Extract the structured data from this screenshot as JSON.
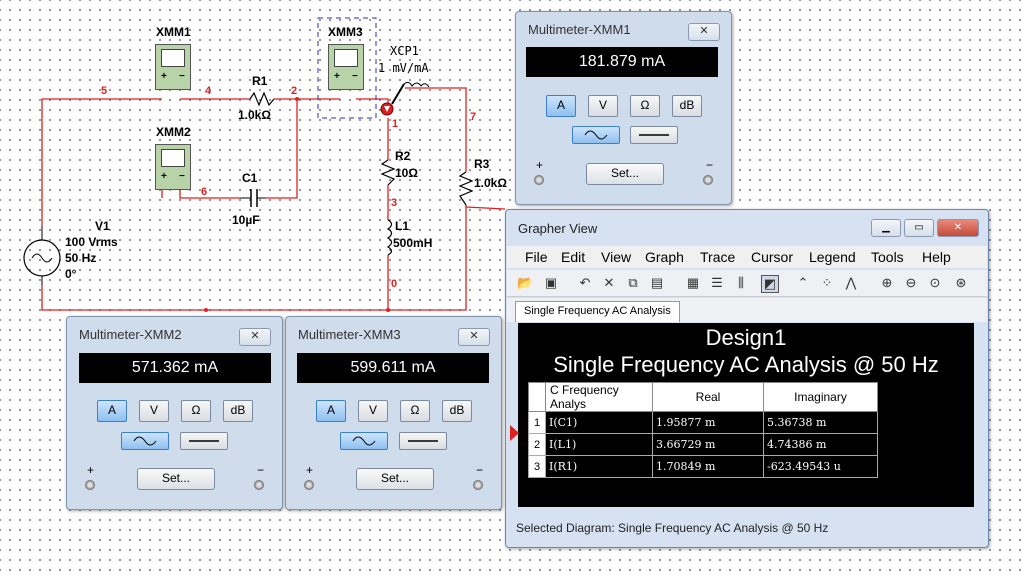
{
  "schematic": {
    "xmm1": "XMM1",
    "xmm2": "XMM2",
    "xmm3": "XMM3",
    "xcp1": "XCP1",
    "xcp1_value": "1  mV/mA",
    "r1": "R1",
    "r1_value": "1.0kΩ",
    "c1": "C1",
    "c1_value": "10µF",
    "r2": "R2",
    "r2_value": "10Ω",
    "l1": "L1",
    "l1_value": "500mH",
    "r3": "R3",
    "r3_value": "1.0kΩ",
    "v1": "V1",
    "v1_amp": "100 Vrms",
    "v1_freq": "50 Hz",
    "v1_phase": "0°",
    "nets": {
      "n5": "5",
      "n4": "4",
      "n2": "2",
      "n6": "6",
      "n1": "1",
      "n3": "3",
      "n0": "0",
      "n7": "7"
    }
  },
  "multimeter_xmm1": {
    "title": "Multimeter-XMM1",
    "reading": "181.879 mA",
    "btn_a": "A",
    "btn_v": "V",
    "btn_ohm": "Ω",
    "btn_db": "dB",
    "set": "Set...",
    "plus": "+",
    "minus": "−"
  },
  "multimeter_xmm2": {
    "title": "Multimeter-XMM2",
    "reading": "571.362 mA",
    "btn_a": "A",
    "btn_v": "V",
    "btn_ohm": "Ω",
    "btn_db": "dB",
    "set": "Set...",
    "plus": "+",
    "minus": "−"
  },
  "multimeter_xmm3": {
    "title": "Multimeter-XMM3",
    "reading": "599.611 mA",
    "btn_a": "A",
    "btn_v": "V",
    "btn_ohm": "Ω",
    "btn_db": "dB",
    "set": "Set...",
    "plus": "+",
    "minus": "−"
  },
  "close_glyph": "✕",
  "grapher": {
    "title": "Grapher View",
    "menu": [
      "File",
      "Edit",
      "View",
      "Graph",
      "Trace",
      "Cursor",
      "Legend",
      "Tools",
      "Help"
    ],
    "tab": "Single Frequency AC Analysis",
    "plot_title": "Design1",
    "plot_subtitle": "Single Frequency AC Analysis @ 50 Hz",
    "table_headers": [
      "C Frequency Analys",
      "Real",
      "Imaginary"
    ],
    "rows": [
      {
        "idx": "1",
        "name": "I(C1)",
        "real": "1.95877 m",
        "imag": "5.36738 m"
      },
      {
        "idx": "2",
        "name": "I(L1)",
        "real": "3.66729 m",
        "imag": "4.74386 m"
      },
      {
        "idx": "3",
        "name": "I(R1)",
        "real": "1.70849 m",
        "imag": "-623.49543 u"
      }
    ],
    "status": "Selected Diagram: Single Frequency AC Analysis @ 50 Hz"
  }
}
